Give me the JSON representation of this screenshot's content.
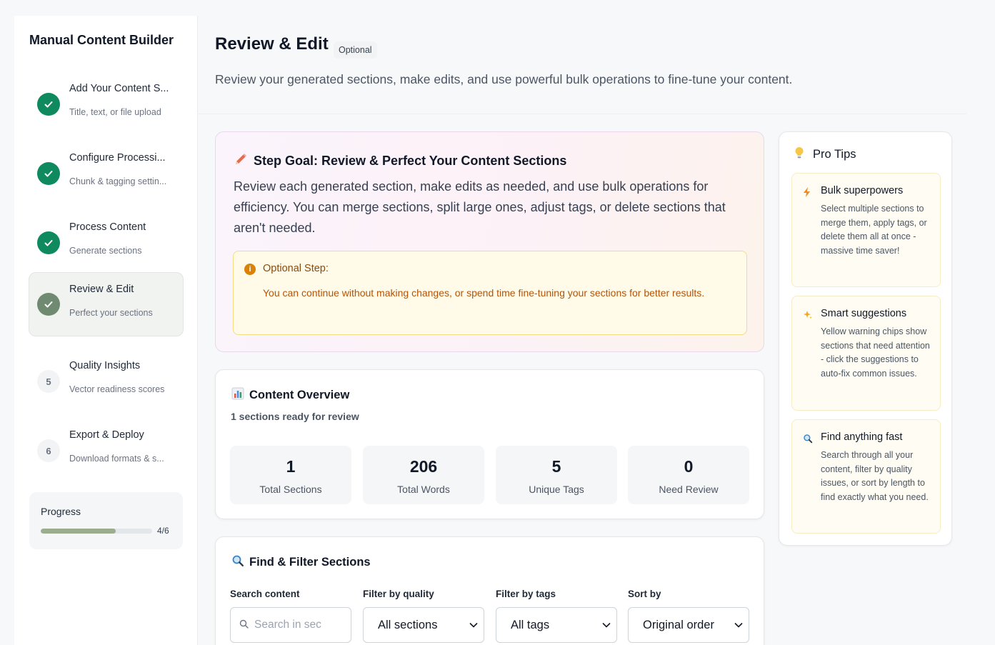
{
  "sidebar": {
    "title": "Manual Content Builder",
    "steps": [
      {
        "title": "Add Your Content S...",
        "subtitle": "Title, text, or file upload",
        "status": "done"
      },
      {
        "title": "Configure Processi...",
        "subtitle": "Chunk & tagging settin...",
        "status": "done"
      },
      {
        "title": "Process Content",
        "subtitle": "Generate sections",
        "status": "done"
      },
      {
        "title": "Review & Edit",
        "subtitle": "Perfect your sections",
        "status": "current"
      },
      {
        "title": "Quality Insights",
        "subtitle": "Vector readiness scores",
        "status": "pending",
        "number": "5"
      },
      {
        "title": "Export & Deploy",
        "subtitle": "Download formats & s...",
        "status": "pending",
        "number": "6"
      }
    ],
    "progress": {
      "label": "Progress",
      "count": "4/6",
      "fraction": 0.67
    }
  },
  "header": {
    "title": "Review & Edit",
    "badge": "Optional",
    "description": "Review your generated sections, make edits, and use powerful bulk operations to fine-tune your content."
  },
  "goal": {
    "icon": "pencil-icon",
    "title": "Step Goal: Review & Perfect Your Content Sections",
    "text": "Review each generated section, make edits as needed, and use bulk operations for efficiency. You can merge sections, split large ones, adjust tags, or delete sections that aren't needed.",
    "notice": {
      "icon": "info-icon",
      "title": "Optional Step:",
      "text": "You can continue without making changes, or spend time fine-tuning your sections for better results."
    }
  },
  "overview": {
    "icon": "bar-chart-icon",
    "title": "Content Overview",
    "subtitle": "1 sections ready for review",
    "stats": [
      {
        "value": "1",
        "label": "Total Sections"
      },
      {
        "value": "206",
        "label": "Total Words"
      },
      {
        "value": "5",
        "label": "Unique Tags"
      },
      {
        "value": "0",
        "label": "Need Review"
      }
    ]
  },
  "filter": {
    "icon": "magnifier-icon",
    "title": "Find & Filter Sections",
    "search": {
      "label": "Search content",
      "placeholder": "Search in sec"
    },
    "quality": {
      "label": "Filter by quality",
      "value": "All sections"
    },
    "tags": {
      "label": "Filter by tags",
      "value": "All tags"
    },
    "sort": {
      "label": "Sort by",
      "value": "Original order"
    }
  },
  "tips": {
    "icon": "lightbulb-icon",
    "title": "Pro Tips",
    "items": [
      {
        "icon": "lightning-icon",
        "title": "Bulk superpowers",
        "text": "Select multiple sections to merge them, apply tags, or delete them all at once - massive time saver!"
      },
      {
        "icon": "sparkles-icon",
        "title": "Smart suggestions",
        "text": "Yellow warning chips show sections that need attention - click the suggestions to auto-fix common issues."
      },
      {
        "icon": "magnifier-icon",
        "title": "Find anything fast",
        "text": "Search through all your content, filter by quality issues, or sort by length to find exactly what you need."
      }
    ]
  },
  "colors": {
    "accent": "#0f8a5f",
    "current_step": "#6f8a70",
    "progress_fill": "#9aae8f",
    "notice_text": "#b45309"
  }
}
